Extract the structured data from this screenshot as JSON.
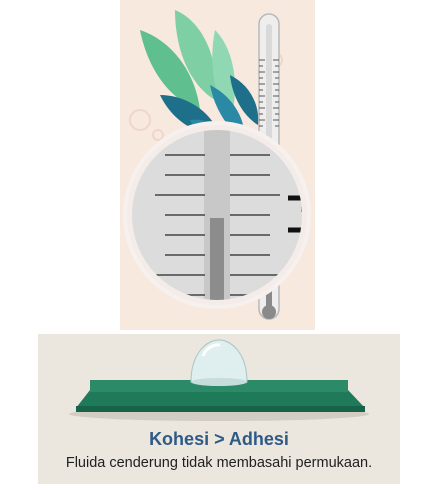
{
  "illustration": {
    "top": {
      "subject": "thermometer-with-magnifier",
      "background_color": "#f8e9df"
    },
    "bottom": {
      "subject": "water-droplet-on-green-surface",
      "background_color": "#ebe6de",
      "surface_color": "#1f7a5a"
    }
  },
  "caption": {
    "title": "Kohesi > Adhesi",
    "text": "Fluida cenderung tidak membasahi permukaan."
  }
}
